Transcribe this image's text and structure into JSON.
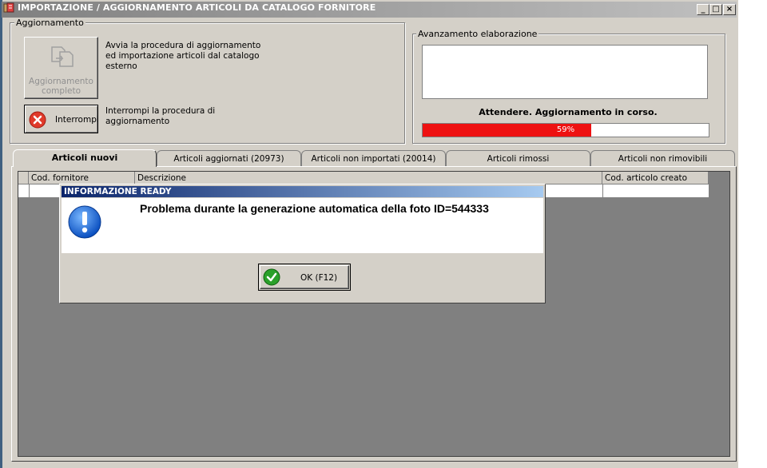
{
  "window": {
    "title": "IMPORTAZIONE / AGGIORNAMENTO ARTICOLI DA CATALOGO FORNITORE",
    "controls": {
      "minimize": "_",
      "maximize": "□",
      "close": "×"
    }
  },
  "aggiornamento": {
    "group_title": "Aggiornamento",
    "full_update_button": {
      "label_line1": "Aggiornamento",
      "label_line2": "completo",
      "icon": "document-transfer-icon"
    },
    "full_update_desc": [
      "Avvia la procedura di aggiornamento",
      "ed importazione articoli dal catalogo",
      "esterno"
    ],
    "stop_button": {
      "label": "Interrompi",
      "icon": "red-x-icon"
    },
    "stop_desc": [
      "Interrompi la procedura di",
      "aggiornamento"
    ]
  },
  "avanzamento": {
    "group_title": "Avanzamento elaborazione",
    "log_text": "",
    "status_text": "Attendere. Aggiornamento in corso.",
    "progress_label": "59%",
    "progress_value": 0.59,
    "progress_color": "#ee1111"
  },
  "tabs": [
    {
      "label": "Articoli nuovi",
      "active": true
    },
    {
      "label": "Articoli aggiornati (20973)",
      "active": false
    },
    {
      "label": "Articoli non importati (20014)",
      "active": false
    },
    {
      "label": "Articoli rimossi",
      "active": false
    },
    {
      "label": "Articoli non rimovibili",
      "active": false
    }
  ],
  "grid": {
    "columns": [
      "Cod. fornitore",
      "Descrizione",
      "Cod. articolo creato"
    ],
    "rows": []
  },
  "dialog": {
    "title": "INFORMAZIONE READY",
    "message": "Problema durante la generazione automatica della foto ID=544333",
    "icon": "info-exclamation-icon",
    "ok_button": {
      "label": "OK (F12)",
      "icon": "green-check-icon"
    }
  }
}
